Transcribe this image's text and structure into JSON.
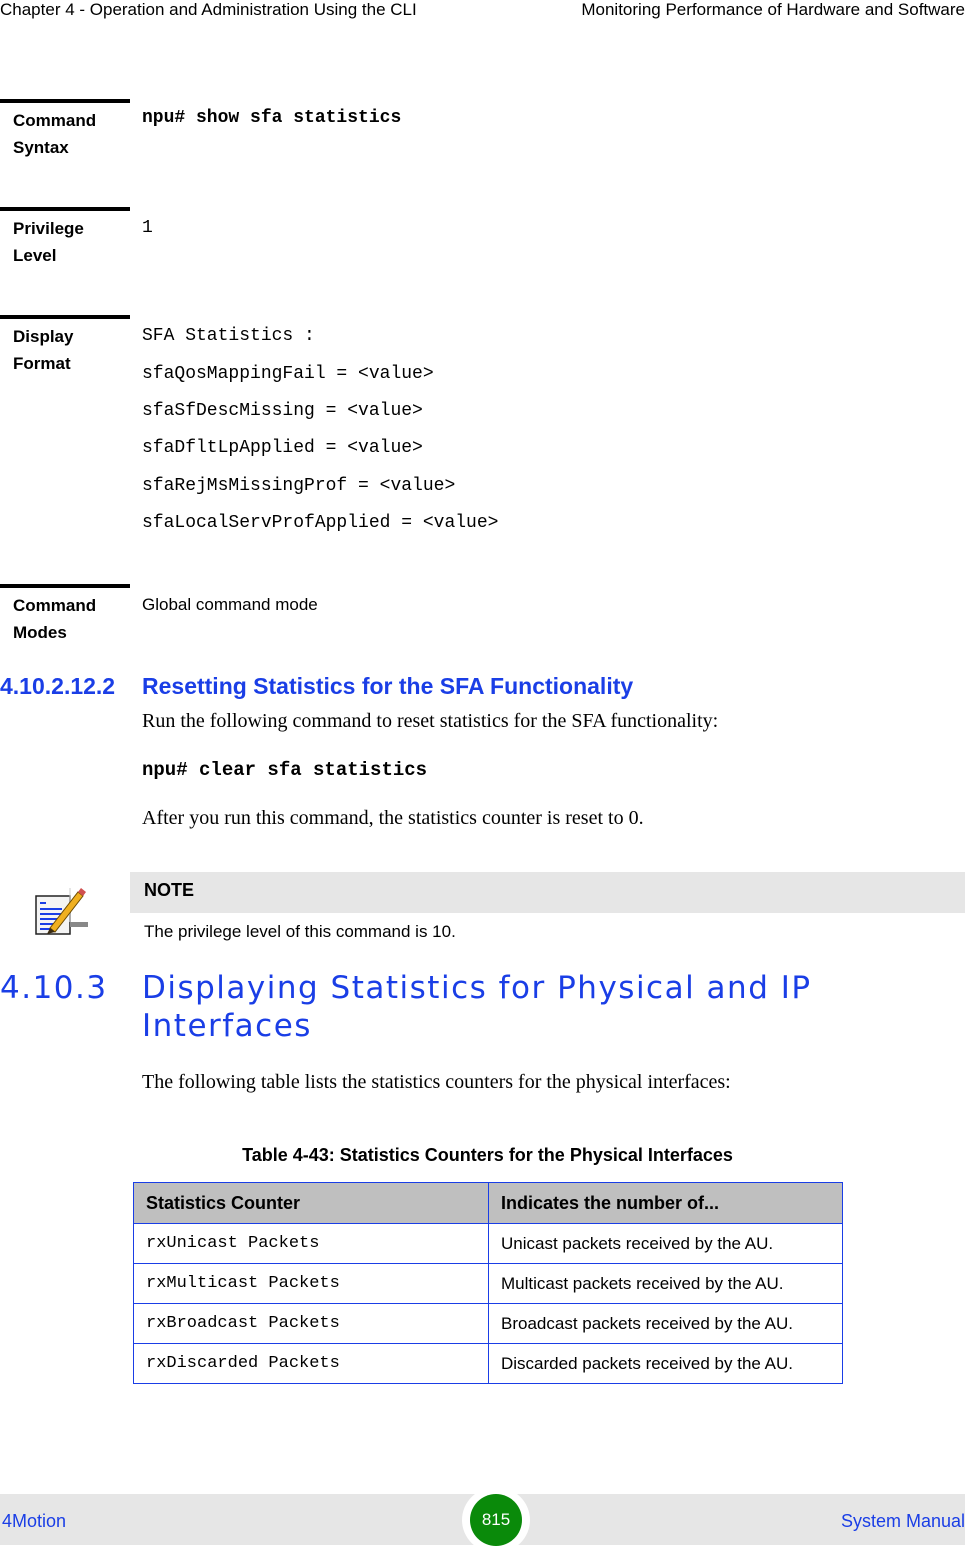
{
  "header": {
    "chapter": "Chapter 4 - Operation and Administration Using the CLI",
    "section": "Monitoring Performance of Hardware and Software"
  },
  "spec": {
    "command_syntax": {
      "label": "Command Syntax",
      "value": "npu# show sfa statistics"
    },
    "privilege_level": {
      "label": "Privilege Level",
      "value": "1"
    },
    "display_format": {
      "label": "Display Format",
      "lines": [
        "SFA Statistics :",
        "sfaQosMappingFail = <value>",
        "sfaSfDescMissing = <value>",
        "sfaDfltLpApplied = <value>",
        "sfaRejMsMissingProf = <value>",
        "sfaLocalServProfApplied = <value>"
      ]
    },
    "command_modes": {
      "label": "Command Modes",
      "value": "Global command mode"
    }
  },
  "section_reset": {
    "number": "4.10.2.12.2",
    "title": "Resetting Statistics for the SFA Functionality",
    "intro": "Run the following command to reset statistics for the SFA functionality:",
    "command": "npu# clear sfa statistics",
    "after": "After you run this command, the statistics counter is reset to 0."
  },
  "note": {
    "title": "NOTE",
    "text": "The privilege level of this command is 10.",
    "icon": "note-pencil-icon"
  },
  "section_interfaces": {
    "number": "4.10.3",
    "title_line1": "Displaying Statistics for Physical and IP",
    "title_line2": "Interfaces",
    "intro": "The following table lists the statistics counters for the physical interfaces:"
  },
  "table": {
    "caption": "Table 4-43: Statistics Counters for the Physical Interfaces",
    "headers": [
      "Statistics Counter",
      "Indicates the number of..."
    ],
    "rows": [
      [
        "rxUnicast Packets",
        "Unicast packets received by the AU."
      ],
      [
        "rxMulticast Packets",
        "Multicast packets received by the AU."
      ],
      [
        "rxBroadcast Packets",
        "Broadcast packets received by the AU."
      ],
      [
        "rxDiscarded Packets",
        "Discarded packets received by the AU."
      ]
    ]
  },
  "footer": {
    "product": "4Motion",
    "page": "815",
    "doc": "System Manual"
  },
  "colors": {
    "heading_blue": "#1a3ee6",
    "page_badge_green": "#0a8a0a",
    "table_header_gray": "#bfbfbf",
    "note_bar_gray": "#e6e6e6"
  }
}
